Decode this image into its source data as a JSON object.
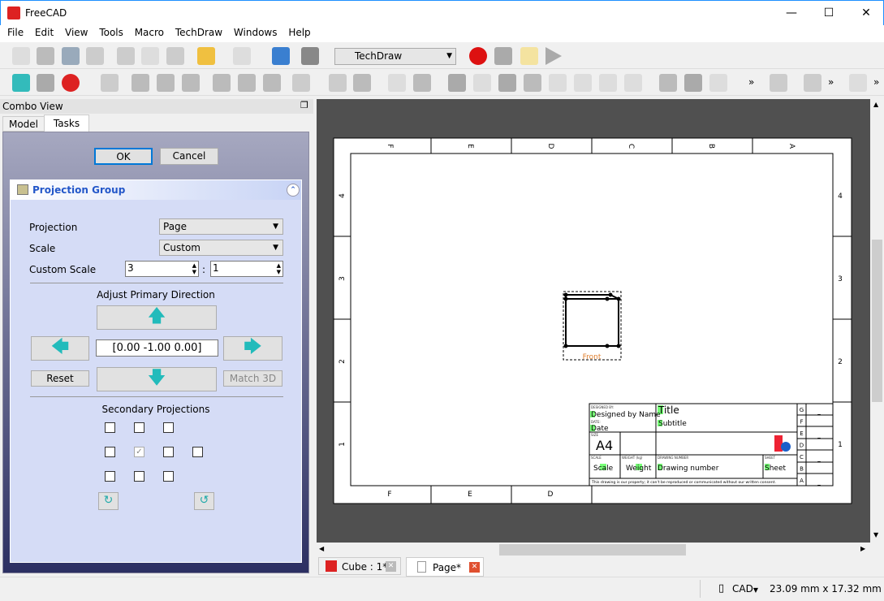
{
  "app": {
    "title": "FreeCAD",
    "accent": "#1e90ff"
  },
  "menu": [
    "File",
    "Edit",
    "View",
    "Tools",
    "Macro",
    "TechDraw",
    "Windows",
    "Help"
  ],
  "toolbar": {
    "workbench": "TechDraw",
    "overflow": "»"
  },
  "combo": {
    "title": "Combo View",
    "tabs": [
      "Model",
      "Tasks"
    ],
    "active_tab": "Tasks"
  },
  "task": {
    "ok": "OK",
    "cancel": "Cancel",
    "group_title": "Projection Group",
    "projection_label": "Projection",
    "projection_value": "Page",
    "scale_label": "Scale",
    "scale_value": "Custom",
    "custom_scale_label": "Custom Scale",
    "scale_num": "3",
    "scale_sep": ":",
    "scale_den": "1",
    "adjust_label": "Adjust Primary Direction",
    "direction": "[0.00 -1.00 0.00]",
    "reset": "Reset",
    "match3d": "Match 3D",
    "secondary_label": "Secondary Projections",
    "checkboxes": [
      [
        false,
        false,
        false,
        null
      ],
      [
        false,
        true,
        false,
        false
      ],
      [
        false,
        false,
        false,
        null
      ]
    ]
  },
  "drawing": {
    "top_cols": [
      "F",
      "E",
      "D",
      "C",
      "B",
      "A"
    ],
    "bottom_cols": [
      "F",
      "E",
      "D"
    ],
    "rows": [
      "4",
      "3",
      "2",
      "1"
    ],
    "view_label": "Front",
    "titleblock": {
      "designed_by_label": "DESIGNED BY:",
      "designed_by": "Designed by Name",
      "date_label": "DATE:",
      "date": "Date",
      "title": "Title",
      "subtitle": "Subtitle",
      "size_label": "SIZE",
      "size": "A4",
      "scale_label": "SCALE",
      "scale": "Scale",
      "weight_label": "WEIGHT (kg)",
      "weight": "Weight",
      "drawing_number_label": "DRAWING NUMBER",
      "drawing_number": "Drawing number",
      "sheet_label": "SHEET",
      "sheet": "Sheet",
      "disclaimer": "This drawing is our property; it can't be reproduced or communicated without our written consent.",
      "revisions": [
        "G",
        "F",
        "E",
        "D",
        "C",
        "B",
        "A"
      ],
      "revision_value": "_"
    }
  },
  "doc_tabs": [
    {
      "label": "Cube : 1*"
    },
    {
      "label": "Page*",
      "active": true
    }
  ],
  "status": {
    "nav": "CAD",
    "dimensions": "23.09 mm x 17.32 mm"
  }
}
